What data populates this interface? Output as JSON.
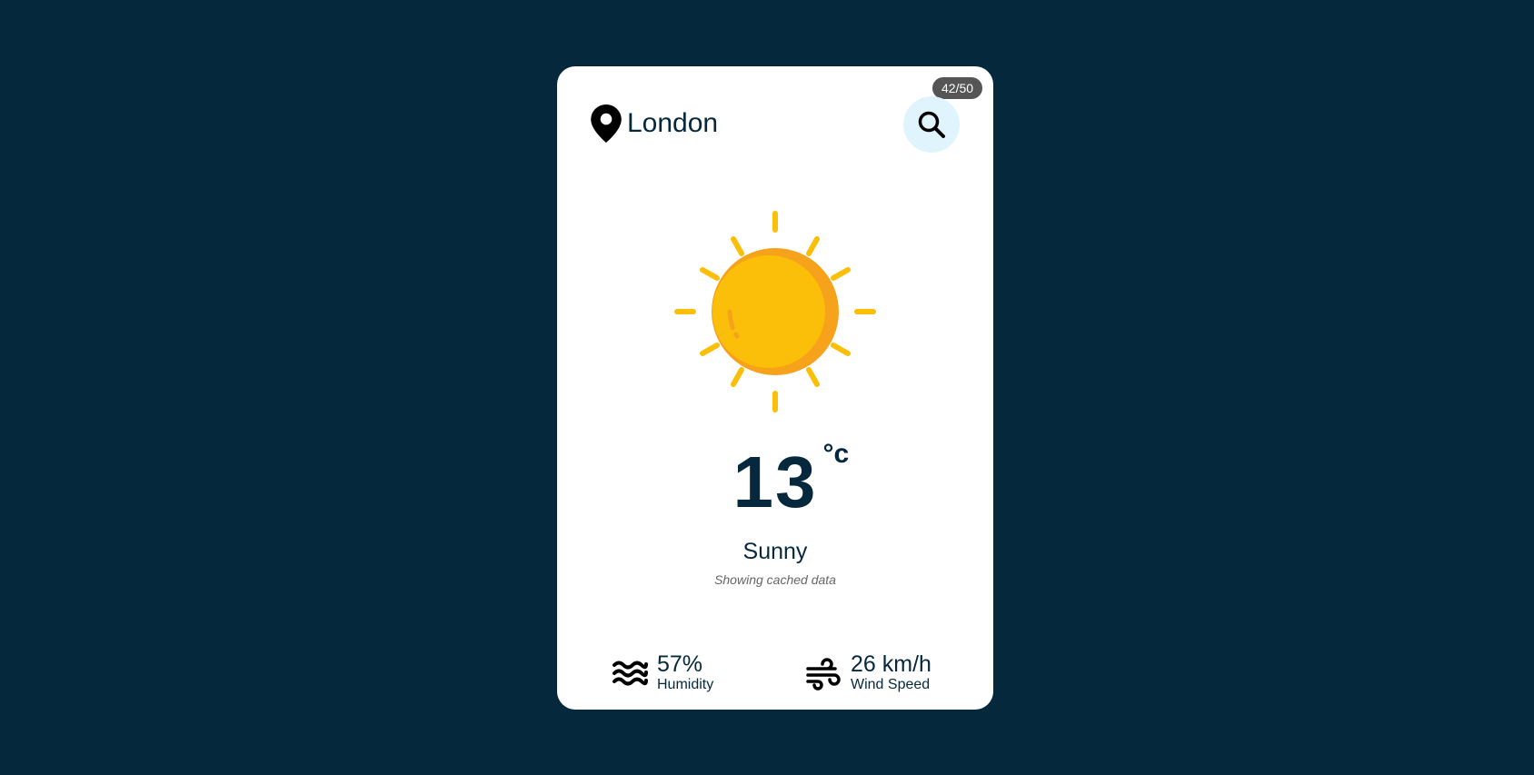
{
  "usage": {
    "count": "42/50"
  },
  "location": {
    "city": "London",
    "icon": "map-pin-icon"
  },
  "search": {
    "icon": "search-icon"
  },
  "weather": {
    "image": "sun-icon",
    "temperature": "13",
    "unit": "°c",
    "description": "Sunny",
    "note": "Showing cached data"
  },
  "details": {
    "humidity": {
      "value": "57%",
      "label": "Humidity",
      "icon": "water-waves-icon"
    },
    "wind": {
      "value": "26 km/h",
      "label": "Wind Speed",
      "icon": "wind-icon"
    }
  },
  "colors": {
    "background": "#06283d",
    "card": "#ffffff",
    "text": "#06283d",
    "search_bg": "#dff4fd",
    "sun_main": "#fbbf0a",
    "sun_shadow": "#f7a21b",
    "badge": "#555555"
  }
}
